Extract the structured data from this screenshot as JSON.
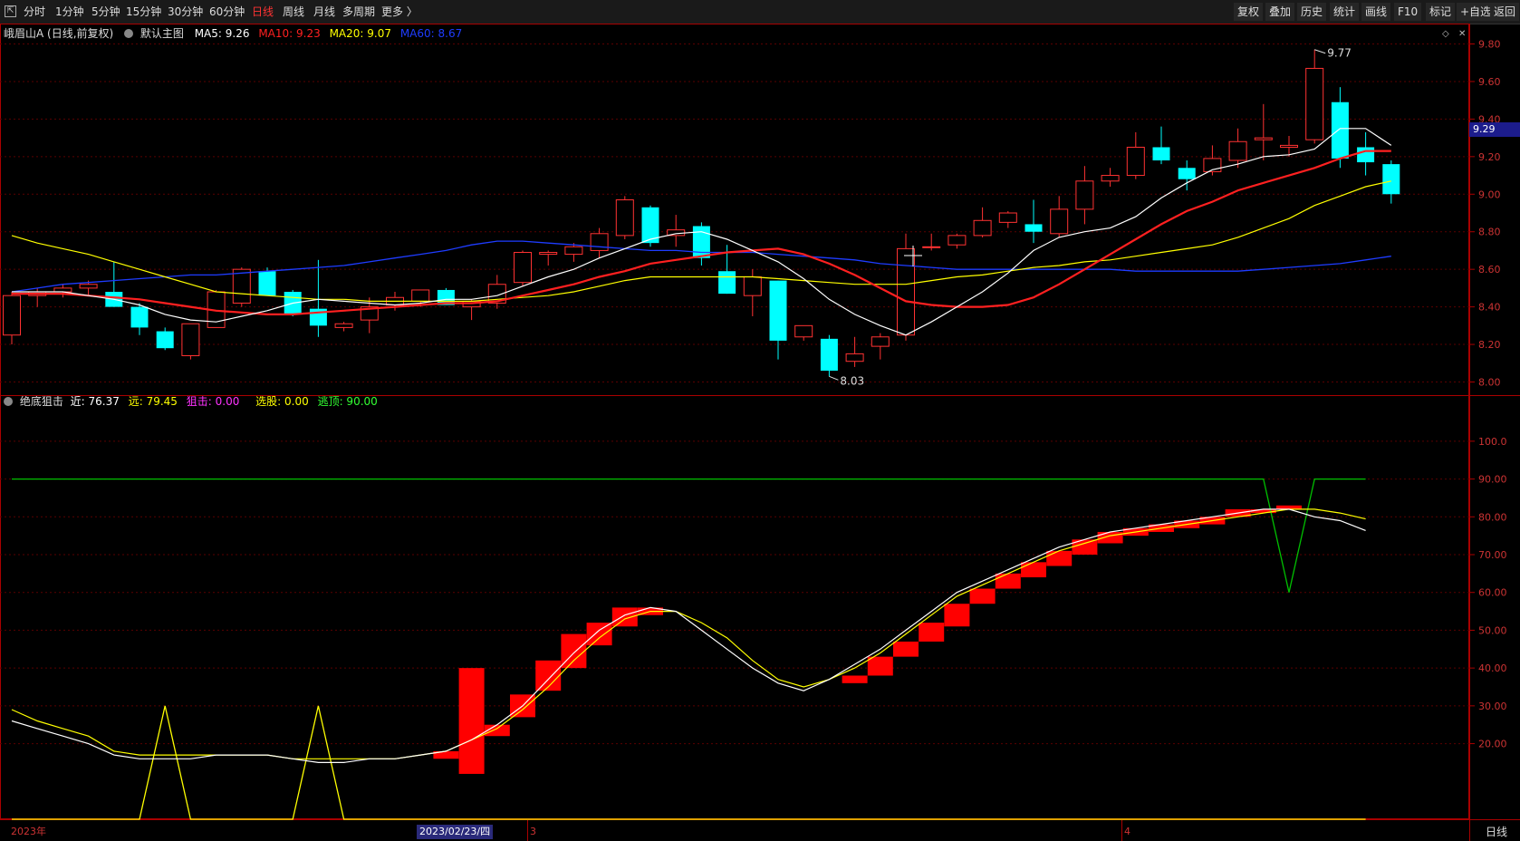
{
  "toolbar": {
    "tabs": [
      {
        "label": "分时",
        "active": false
      },
      {
        "label": "1分钟",
        "active": false
      },
      {
        "label": "5分钟",
        "active": false
      },
      {
        "label": "15分钟",
        "active": false
      },
      {
        "label": "30分钟",
        "active": false
      },
      {
        "label": "60分钟",
        "active": false
      },
      {
        "label": "日线",
        "active": true
      },
      {
        "label": "周线",
        "active": false
      },
      {
        "label": "月线",
        "active": false
      },
      {
        "label": "多周期",
        "active": false
      },
      {
        "label": "更多 〉",
        "active": false
      }
    ],
    "right_buttons": [
      "复权",
      "叠加",
      "历史",
      "统计",
      "画线",
      "F10",
      "标记",
      "+自选",
      "返回"
    ]
  },
  "main_panel": {
    "stock_label": "峨眉山A (日线,前复权)",
    "template_label": "默认主图",
    "ma5": "MA5: 9.26",
    "ma10": "MA10: 9.23",
    "ma20": "MA20: 9.07",
    "ma60": "MA60: 8.67",
    "high_marker": "9.77",
    "low_marker": "8.03",
    "current_price": "9.29",
    "ticks": [
      "9.80",
      "9.60",
      "9.40",
      "9.20",
      "9.00",
      "8.80",
      "8.60",
      "8.40",
      "8.20",
      "8.00"
    ]
  },
  "sub_panel": {
    "indicator_name": "绝底狙击",
    "near": "近: 76.37",
    "far": "远: 79.45",
    "snipe": "狙击: 0.00",
    "select": "选股: 0.00",
    "escape": "逃顶: 90.00",
    "ticks": [
      "100.0",
      "90.00",
      "80.00",
      "70.00",
      "60.00",
      "50.00",
      "40.00",
      "30.00",
      "20.00"
    ]
  },
  "xaxis": {
    "year_label": "2023年",
    "cursor_date": "2023/02/23/四",
    "month_3": "3",
    "month_4": "4",
    "period": "日线"
  },
  "colors": {
    "up": "#ff3232",
    "down": "#00ffff",
    "ma5": "#ffffff",
    "ma10": "#ff2020",
    "ma20": "#ffff00",
    "ma60": "#1e3cff",
    "grid": "#5a0000",
    "axis": "#aa0000"
  },
  "chart_data": [
    {
      "type": "candlestick",
      "title": "峨眉山A (日线,前复权)",
      "ylim": [
        7.93,
        9.87
      ],
      "candles": [
        {
          "o": 8.25,
          "h": 8.48,
          "l": 8.2,
          "c": 8.46
        },
        {
          "o": 8.46,
          "h": 8.5,
          "l": 8.4,
          "c": 8.48
        },
        {
          "o": 8.48,
          "h": 8.52,
          "l": 8.45,
          "c": 8.5
        },
        {
          "o": 8.5,
          "h": 8.54,
          "l": 8.46,
          "c": 8.52
        },
        {
          "o": 8.48,
          "h": 8.64,
          "l": 8.4,
          "c": 8.4
        },
        {
          "o": 8.4,
          "h": 8.42,
          "l": 8.25,
          "c": 8.29
        },
        {
          "o": 8.27,
          "h": 8.29,
          "l": 8.17,
          "c": 8.18
        },
        {
          "o": 8.14,
          "h": 8.31,
          "l": 8.12,
          "c": 8.31
        },
        {
          "o": 8.29,
          "h": 8.49,
          "l": 8.29,
          "c": 8.48
        },
        {
          "o": 8.42,
          "h": 8.61,
          "l": 8.4,
          "c": 8.6
        },
        {
          "o": 8.59,
          "h": 8.61,
          "l": 8.46,
          "c": 8.46
        },
        {
          "o": 8.48,
          "h": 8.49,
          "l": 8.35,
          "c": 8.36
        },
        {
          "o": 8.39,
          "h": 8.65,
          "l": 8.24,
          "c": 8.3
        },
        {
          "o": 8.29,
          "h": 8.32,
          "l": 8.27,
          "c": 8.31
        },
        {
          "o": 8.33,
          "h": 8.45,
          "l": 8.26,
          "c": 8.4
        },
        {
          "o": 8.41,
          "h": 8.48,
          "l": 8.38,
          "c": 8.45
        },
        {
          "o": 8.43,
          "h": 8.49,
          "l": 8.4,
          "c": 8.49
        },
        {
          "o": 8.49,
          "h": 8.5,
          "l": 8.41,
          "c": 8.41
        },
        {
          "o": 8.4,
          "h": 8.44,
          "l": 8.33,
          "c": 8.43
        },
        {
          "o": 8.42,
          "h": 8.57,
          "l": 8.39,
          "c": 8.52
        },
        {
          "o": 8.53,
          "h": 8.7,
          "l": 8.51,
          "c": 8.69
        },
        {
          "o": 8.68,
          "h": 8.7,
          "l": 8.62,
          "c": 8.69
        },
        {
          "o": 8.68,
          "h": 8.74,
          "l": 8.64,
          "c": 8.72
        },
        {
          "o": 8.7,
          "h": 8.82,
          "l": 8.66,
          "c": 8.79
        },
        {
          "o": 8.78,
          "h": 8.99,
          "l": 8.76,
          "c": 8.97
        },
        {
          "o": 8.93,
          "h": 8.94,
          "l": 8.72,
          "c": 8.74
        },
        {
          "o": 8.78,
          "h": 8.89,
          "l": 8.72,
          "c": 8.81
        },
        {
          "o": 8.83,
          "h": 8.85,
          "l": 8.62,
          "c": 8.66
        },
        {
          "o": 8.59,
          "h": 8.73,
          "l": 8.47,
          "c": 8.47
        },
        {
          "o": 8.46,
          "h": 8.6,
          "l": 8.35,
          "c": 8.56
        },
        {
          "o": 8.54,
          "h": 8.54,
          "l": 8.12,
          "c": 8.22
        },
        {
          "o": 8.24,
          "h": 8.3,
          "l": 8.22,
          "c": 8.3
        },
        {
          "o": 8.23,
          "h": 8.25,
          "l": 8.03,
          "c": 8.06
        },
        {
          "o": 8.11,
          "h": 8.24,
          "l": 8.08,
          "c": 8.15
        },
        {
          "o": 8.19,
          "h": 8.26,
          "l": 8.12,
          "c": 8.24
        },
        {
          "o": 8.25,
          "h": 8.79,
          "l": 8.22,
          "c": 8.71
        },
        {
          "o": 8.72,
          "h": 8.79,
          "l": 8.7,
          "c": 8.72
        },
        {
          "o": 8.73,
          "h": 8.79,
          "l": 8.71,
          "c": 8.78
        },
        {
          "o": 8.78,
          "h": 8.93,
          "l": 8.77,
          "c": 8.86
        },
        {
          "o": 8.85,
          "h": 8.91,
          "l": 8.82,
          "c": 8.9
        },
        {
          "o": 8.84,
          "h": 8.97,
          "l": 8.74,
          "c": 8.8
        },
        {
          "o": 8.79,
          "h": 8.99,
          "l": 8.77,
          "c": 8.92
        },
        {
          "o": 8.92,
          "h": 9.15,
          "l": 8.84,
          "c": 9.07
        },
        {
          "o": 9.07,
          "h": 9.14,
          "l": 9.04,
          "c": 9.1
        },
        {
          "o": 9.1,
          "h": 9.33,
          "l": 9.08,
          "c": 9.25
        },
        {
          "o": 9.25,
          "h": 9.36,
          "l": 9.16,
          "c": 9.18
        },
        {
          "o": 9.14,
          "h": 9.18,
          "l": 9.02,
          "c": 9.08
        },
        {
          "o": 9.12,
          "h": 9.26,
          "l": 9.1,
          "c": 9.19
        },
        {
          "o": 9.18,
          "h": 9.35,
          "l": 9.14,
          "c": 9.28
        },
        {
          "o": 9.29,
          "h": 9.48,
          "l": 9.18,
          "c": 9.3
        },
        {
          "o": 9.25,
          "h": 9.31,
          "l": 9.2,
          "c": 9.26
        },
        {
          "o": 9.29,
          "h": 9.77,
          "l": 9.27,
          "c": 9.67
        },
        {
          "o": 9.49,
          "h": 9.57,
          "l": 9.14,
          "c": 9.19
        },
        {
          "o": 9.25,
          "h": 9.33,
          "l": 9.1,
          "c": 9.17
        },
        {
          "o": 9.16,
          "h": 9.18,
          "l": 8.95,
          "c": 9.0
        }
      ],
      "ma5": [
        8.48,
        8.48,
        8.48,
        8.46,
        8.44,
        8.41,
        8.36,
        8.33,
        8.32,
        8.35,
        8.38,
        8.42,
        8.44,
        8.43,
        8.42,
        8.41,
        8.42,
        8.44,
        8.44,
        8.46,
        8.51,
        8.56,
        8.6,
        8.66,
        8.71,
        8.76,
        8.79,
        8.8,
        8.76,
        8.7,
        8.64,
        8.55,
        8.44,
        8.36,
        8.3,
        8.25,
        8.32,
        8.4,
        8.48,
        8.58,
        8.7,
        8.77,
        8.8,
        8.82,
        8.88,
        8.98,
        9.06,
        9.13,
        9.16,
        9.2,
        9.21,
        9.24,
        9.35,
        9.35,
        9.26
      ],
      "ma10": [
        8.47,
        8.47,
        8.47,
        8.46,
        8.45,
        8.44,
        8.42,
        8.4,
        8.38,
        8.37,
        8.36,
        8.36,
        8.37,
        8.38,
        8.39,
        8.4,
        8.41,
        8.42,
        8.42,
        8.43,
        8.46,
        8.49,
        8.52,
        8.56,
        8.59,
        8.63,
        8.65,
        8.67,
        8.69,
        8.7,
        8.71,
        8.68,
        8.63,
        8.57,
        8.5,
        8.43,
        8.41,
        8.4,
        8.4,
        8.41,
        8.45,
        8.52,
        8.6,
        8.68,
        8.76,
        8.84,
        8.91,
        8.96,
        9.02,
        9.06,
        9.1,
        9.14,
        9.19,
        9.23,
        9.23
      ],
      "ma20": [
        8.78,
        8.74,
        8.71,
        8.68,
        8.64,
        8.6,
        8.56,
        8.52,
        8.48,
        8.47,
        8.46,
        8.45,
        8.44,
        8.44,
        8.43,
        8.43,
        8.43,
        8.43,
        8.43,
        8.44,
        8.45,
        8.46,
        8.48,
        8.51,
        8.54,
        8.56,
        8.56,
        8.56,
        8.56,
        8.56,
        8.55,
        8.54,
        8.53,
        8.52,
        8.52,
        8.52,
        8.54,
        8.56,
        8.57,
        8.59,
        8.61,
        8.62,
        8.64,
        8.65,
        8.67,
        8.69,
        8.71,
        8.73,
        8.77,
        8.82,
        8.87,
        8.94,
        8.99,
        9.04,
        9.07
      ],
      "ma60": [
        8.48,
        8.5,
        8.52,
        8.53,
        8.54,
        8.55,
        8.56,
        8.57,
        8.57,
        8.58,
        8.59,
        8.6,
        8.61,
        8.62,
        8.64,
        8.66,
        8.68,
        8.7,
        8.73,
        8.75,
        8.75,
        8.74,
        8.73,
        8.72,
        8.71,
        8.7,
        8.7,
        8.69,
        8.69,
        8.69,
        8.68,
        8.67,
        8.66,
        8.65,
        8.63,
        8.62,
        8.61,
        8.6,
        8.6,
        8.6,
        8.6,
        8.6,
        8.6,
        8.6,
        8.59,
        8.59,
        8.59,
        8.59,
        8.59,
        8.6,
        8.61,
        8.62,
        8.63,
        8.65,
        8.67
      ]
    },
    {
      "type": "line",
      "title": "绝底狙击",
      "ylim": [
        0,
        105
      ],
      "near": [
        26,
        24,
        22,
        20,
        17,
        16,
        16,
        16,
        17,
        17,
        17,
        16,
        15,
        15,
        16,
        16,
        17,
        18,
        21,
        25,
        30,
        37,
        44,
        50,
        54,
        56,
        55,
        50,
        45,
        40,
        36,
        34,
        37,
        41,
        45,
        50,
        55,
        60,
        63,
        66,
        69,
        72,
        74,
        76,
        77,
        78,
        79,
        80,
        81,
        82,
        82,
        80,
        79,
        76.37
      ],
      "far": [
        29,
        26,
        24,
        22,
        18,
        17,
        17,
        17,
        17,
        17,
        17,
        16,
        16,
        16,
        16,
        16,
        17,
        18,
        21,
        24,
        29,
        35,
        42,
        48,
        53,
        55,
        55,
        52,
        48,
        42,
        37,
        35,
        37,
        40,
        44,
        49,
        54,
        59,
        62,
        65,
        68,
        71,
        73,
        75,
        76,
        77,
        78,
        79,
        80,
        81,
        82,
        82,
        81,
        79.45
      ],
      "escape": [
        90,
        90,
        90,
        90,
        90,
        90,
        90,
        90,
        90,
        90,
        90,
        90,
        90,
        90,
        90,
        90,
        90,
        90,
        90,
        90,
        90,
        90,
        90,
        90,
        90,
        90,
        90,
        90,
        90,
        90,
        90,
        90,
        90,
        90,
        90,
        90,
        90,
        90,
        90,
        90,
        90,
        90,
        90,
        90,
        90,
        90,
        90,
        90,
        90,
        90,
        60,
        90,
        90,
        90
      ],
      "select": [
        0,
        0,
        0,
        0,
        0,
        0,
        30,
        0,
        0,
        0,
        0,
        0,
        30,
        0,
        0,
        0,
        0,
        0,
        0,
        0,
        0,
        0,
        0,
        0,
        0,
        0,
        0,
        0,
        0,
        0,
        0,
        0,
        0,
        0,
        0,
        0,
        0,
        0,
        0,
        0,
        0,
        0,
        0,
        0,
        0,
        0,
        0,
        0,
        0,
        0,
        0,
        0,
        0,
        0
      ],
      "bars": [
        {
          "i": 17,
          "lo": 16,
          "hi": 18
        },
        {
          "i": 18,
          "lo": 12,
          "hi": 40
        },
        {
          "i": 19,
          "lo": 22,
          "hi": 25
        },
        {
          "i": 20,
          "lo": 27,
          "hi": 33
        },
        {
          "i": 21,
          "lo": 34,
          "hi": 42
        },
        {
          "i": 22,
          "lo": 40,
          "hi": 49
        },
        {
          "i": 23,
          "lo": 46,
          "hi": 52
        },
        {
          "i": 24,
          "lo": 51,
          "hi": 56
        },
        {
          "i": 25,
          "lo": 54,
          "hi": 56
        },
        {
          "i": 33,
          "lo": 36,
          "hi": 38
        },
        {
          "i": 34,
          "lo": 38,
          "hi": 43
        },
        {
          "i": 35,
          "lo": 43,
          "hi": 47
        },
        {
          "i": 36,
          "lo": 47,
          "hi": 52
        },
        {
          "i": 37,
          "lo": 51,
          "hi": 57
        },
        {
          "i": 38,
          "lo": 57,
          "hi": 61
        },
        {
          "i": 39,
          "lo": 61,
          "hi": 65
        },
        {
          "i": 40,
          "lo": 64,
          "hi": 68
        },
        {
          "i": 41,
          "lo": 67,
          "hi": 71
        },
        {
          "i": 42,
          "lo": 70,
          "hi": 74
        },
        {
          "i": 43,
          "lo": 73,
          "hi": 76
        },
        {
          "i": 44,
          "lo": 75,
          "hi": 77
        },
        {
          "i": 45,
          "lo": 76,
          "hi": 78
        },
        {
          "i": 46,
          "lo": 77,
          "hi": 79
        },
        {
          "i": 47,
          "lo": 78,
          "hi": 80
        },
        {
          "i": 48,
          "lo": 80,
          "hi": 82
        },
        {
          "i": 49,
          "lo": 81,
          "hi": 82
        },
        {
          "i": 50,
          "lo": 82,
          "hi": 83
        }
      ]
    }
  ]
}
